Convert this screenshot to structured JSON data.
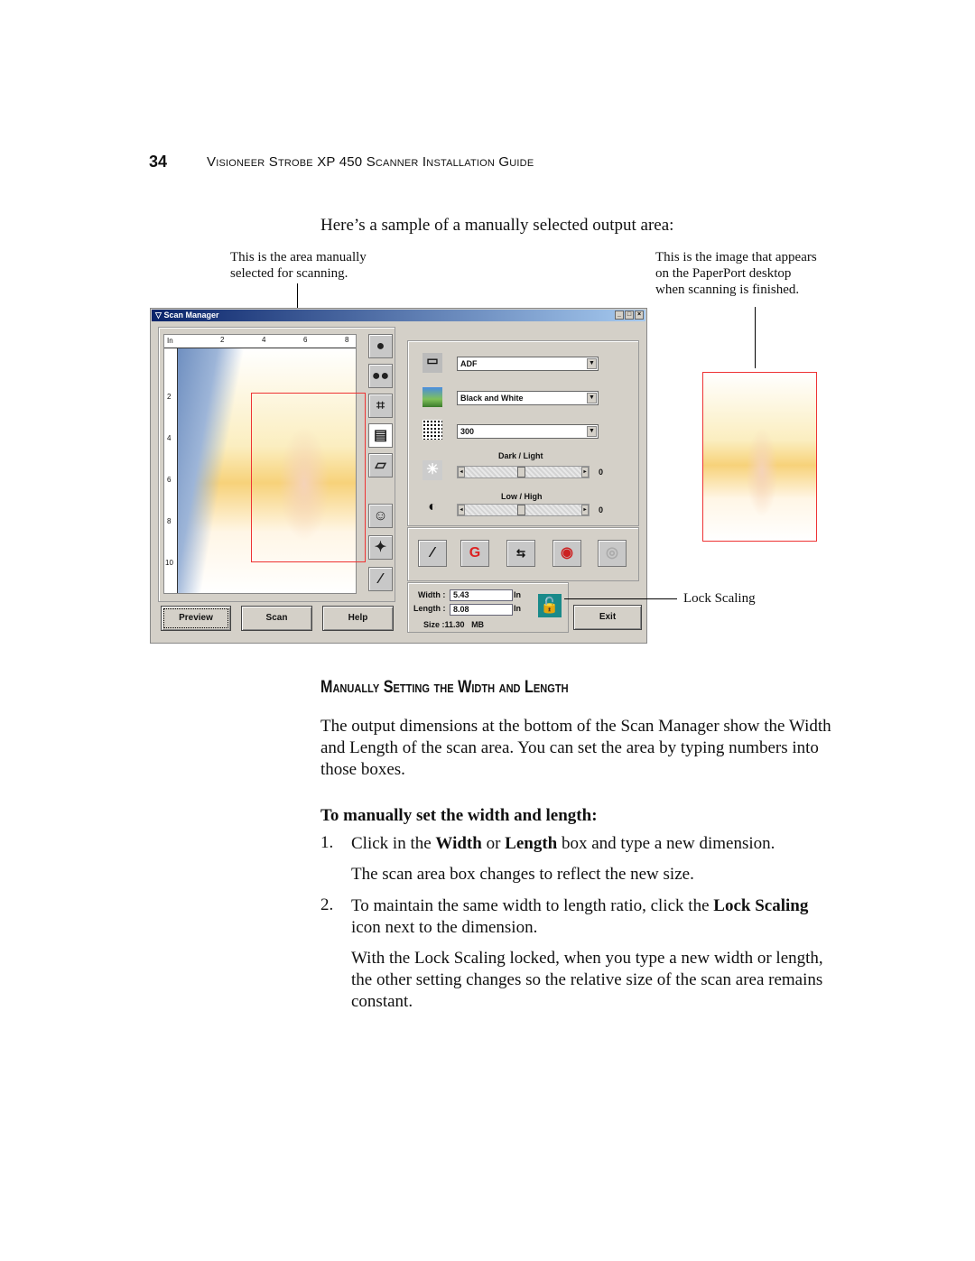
{
  "header": {
    "page_number": "34",
    "title": "Visioneer Strobe XP 450 Scanner Installation Guide"
  },
  "caption": "Here’s a sample of a manually selected output area:",
  "callouts": {
    "left": [
      "This is the area manually",
      "selected for scanning."
    ],
    "right": [
      "This is the image that appears",
      "on the PaperPort desktop",
      "when scanning is finished."
    ],
    "lock": "Lock Scaling"
  },
  "scan_manager": {
    "title": "Scan Manager",
    "window_buttons": [
      "_",
      "□",
      "×"
    ],
    "ruler": {
      "unit": "In",
      "top": [
        "2",
        "4",
        "6",
        "8"
      ],
      "left": [
        "2",
        "4",
        "6",
        "8",
        "10"
      ]
    },
    "side_tools": [
      "person-icon",
      "two-people-icon",
      "crop-icon",
      "page-size-icon",
      "ruler-icon",
      "faces-icon",
      "color-fix-icon",
      "eyedropper-icon"
    ],
    "source": {
      "value": "ADF",
      "icon": "scanner-icon"
    },
    "mode": {
      "value": "Black and White",
      "icon": "color-photo-icon"
    },
    "resolution": {
      "value": "300",
      "icon": "halftone-icon"
    },
    "brightness": {
      "label": "Dark / Light",
      "value": "0",
      "level": 0.5
    },
    "contrast": {
      "label": "Low / High",
      "value": "0",
      "level": 0.5
    },
    "filter_tools": [
      "eyedropper-pair-icon",
      "gamma-curve-icon",
      "cmyk-rgb-balance-icon",
      "hue-saturation-icon",
      "descreen-icon"
    ],
    "dimensions": {
      "width_label": "Width :",
      "width": "5.43",
      "length_label": "Length :",
      "length": "8.08",
      "unit": "In",
      "size_label": "Size :",
      "size": "11.30",
      "size_unit": "MB"
    },
    "buttons": {
      "preview": "Preview",
      "scan": "Scan",
      "help": "Help",
      "exit": "Exit"
    }
  },
  "section_heading": "Manually Setting the Width and Length",
  "intro": "The output dimensions at the bottom of the Scan Manager show the Width and Length of the scan area. You can set the area by typing numbers into those boxes.",
  "procedure_title": "To manually set the width and length:",
  "steps": [
    {
      "num": "1.",
      "pre": "Click in the ",
      "b1": "Width",
      "mid": " or ",
      "b2": "Length",
      "post": " box and type a new dimension.",
      "note": "The scan area box changes to reflect the new size."
    },
    {
      "num": "2.",
      "pre": "To maintain the same width to length ratio, click the ",
      "b1": "Lock Scaling",
      "post": " icon next to the dimension.",
      "note": "With the Lock Scaling locked, when you type a new width or length, the other setting changes so the relative size of the scan area remains constant."
    }
  ]
}
